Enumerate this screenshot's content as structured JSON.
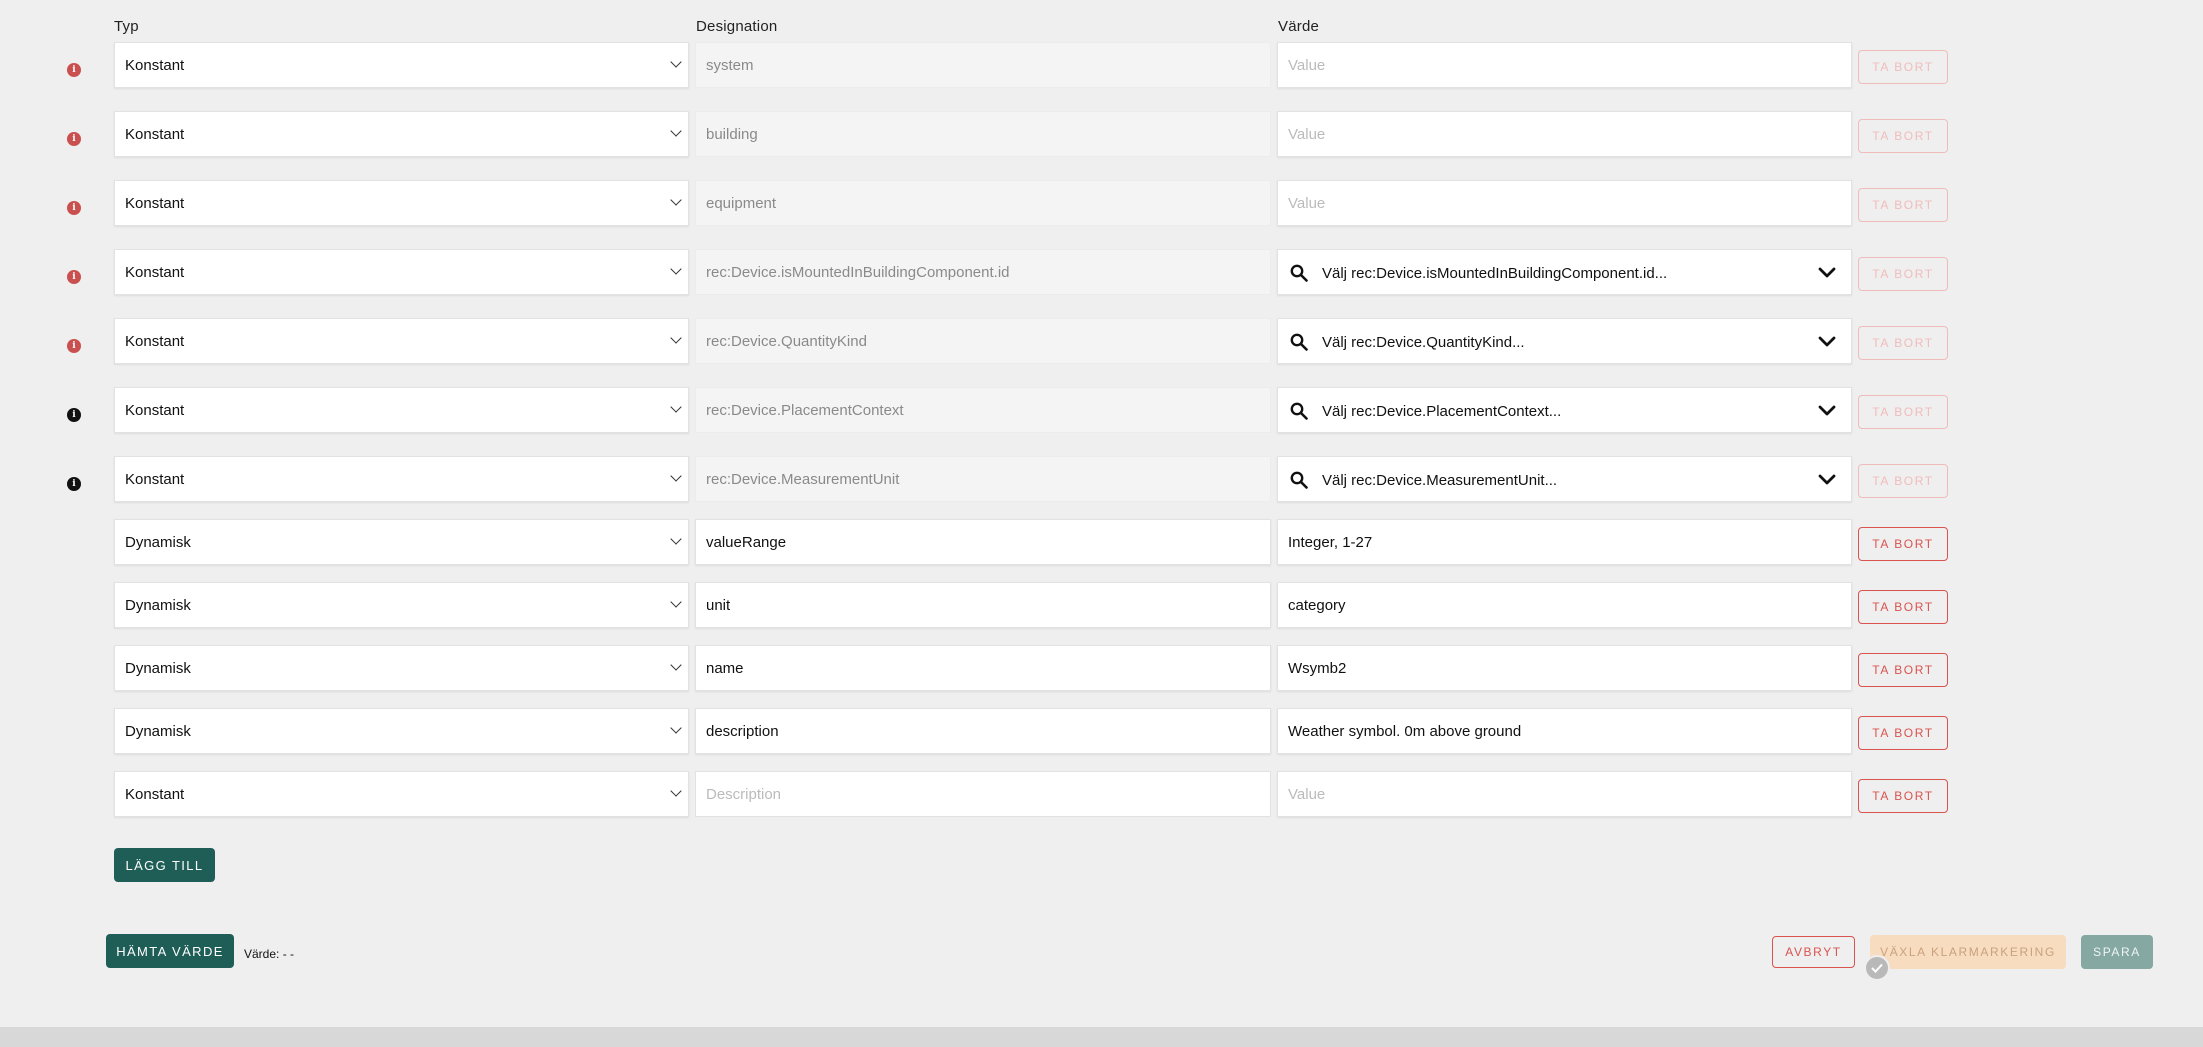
{
  "headers": {
    "type": "Typ",
    "designation": "Designation",
    "value": "Värde"
  },
  "rows": [
    {
      "icon": "info-icon-red",
      "type": "Konstant",
      "designation": "system",
      "designation_state": "disabled",
      "value": "Value",
      "value_kind": "placeholder",
      "remove": "TA BORT",
      "remove_state": "disabled"
    },
    {
      "icon": "info-icon-red",
      "type": "Konstant",
      "designation": "building",
      "designation_state": "disabled",
      "value": "Value",
      "value_kind": "placeholder",
      "remove": "TA BORT",
      "remove_state": "disabled"
    },
    {
      "icon": "info-icon-red",
      "type": "Konstant",
      "designation": "equipment",
      "designation_state": "disabled",
      "value": "Value",
      "value_kind": "placeholder",
      "remove": "TA BORT",
      "remove_state": "disabled"
    },
    {
      "icon": "info-icon-red",
      "type": "Konstant",
      "designation": "rec:Device.isMountedInBuildingComponent.id",
      "designation_state": "disabled",
      "value": "Välj rec:Device.isMountedInBuildingComponent.id...",
      "value_kind": "search-select",
      "remove": "TA BORT",
      "remove_state": "disabled"
    },
    {
      "icon": "info-icon-red",
      "type": "Konstant",
      "designation": "rec:Device.QuantityKind",
      "designation_state": "disabled",
      "value": "Välj rec:Device.QuantityKind...",
      "value_kind": "search-select",
      "remove": "TA BORT",
      "remove_state": "disabled"
    },
    {
      "icon": "info-icon-black",
      "type": "Konstant",
      "designation": "rec:Device.PlacementContext",
      "designation_state": "disabled",
      "value": "Välj rec:Device.PlacementContext...",
      "value_kind": "search-select",
      "remove": "TA BORT",
      "remove_state": "disabled"
    },
    {
      "icon": "info-icon-black",
      "type": "Konstant",
      "designation": "rec:Device.MeasurementUnit",
      "designation_state": "disabled",
      "value": "Välj rec:Device.MeasurementUnit...",
      "value_kind": "search-select",
      "remove": "TA BORT",
      "remove_state": "disabled"
    },
    {
      "icon": "",
      "type": "Dynamisk",
      "designation": "valueRange",
      "designation_state": "active",
      "value": "Integer, 1-27",
      "value_kind": "text",
      "remove": "TA BORT",
      "remove_state": "enabled"
    },
    {
      "icon": "",
      "type": "Dynamisk",
      "designation": "unit",
      "designation_state": "active",
      "value": "category",
      "value_kind": "text",
      "remove": "TA BORT",
      "remove_state": "enabled"
    },
    {
      "icon": "",
      "type": "Dynamisk",
      "designation": "name",
      "designation_state": "active",
      "value": "Wsymb2",
      "value_kind": "text",
      "remove": "TA BORT",
      "remove_state": "enabled"
    },
    {
      "icon": "",
      "type": "Dynamisk",
      "designation": "description",
      "designation_state": "active",
      "value": "Weather symbol. 0m above ground",
      "value_kind": "text",
      "remove": "TA BORT",
      "remove_state": "enabled"
    },
    {
      "icon": "",
      "type": "Konstant",
      "designation": "Description",
      "designation_state": "placeholder",
      "value": "Value",
      "value_kind": "placeholder",
      "remove": "TA BORT",
      "remove_state": "enabled"
    }
  ],
  "actions": {
    "add": "LÄGG TILL",
    "fetch_value": "HÄMTA VÄRDE",
    "value_label": "Värde: - -",
    "cancel": "AVBRYT",
    "toggle_ready": "VÄXLA KLARMARKERING",
    "save": "SPARA"
  },
  "colors": {
    "primary": "#1f5e57",
    "danger": "#d9534f",
    "warning_info": "#c9504f",
    "toggle_bg": "#f8dcbf",
    "save_disabled": "#86a8a2",
    "background": "#efefef"
  }
}
